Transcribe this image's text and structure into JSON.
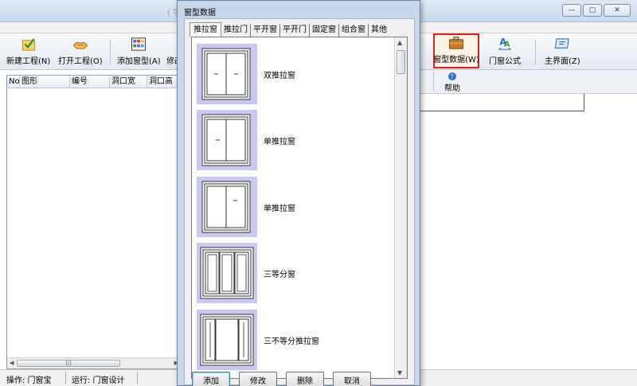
{
  "main": {
    "title": "( 宇",
    "window_buttons": [
      "—",
      "▢",
      "✕"
    ],
    "toolbar": {
      "new_project": "新建工程(N)",
      "open_project": "打开工程(O)",
      "add_window": "添加窗型(A)",
      "modify": "修改",
      "window_data": "窗型数据(W)",
      "formula": "门窗公式",
      "main_screen": "主界面(Z)"
    },
    "toolbar2": {
      "help": "帮助"
    },
    "table": {
      "columns": [
        "No",
        "图形",
        "编号",
        "洞口宽",
        "洞口高"
      ]
    },
    "status": {
      "operator_label": "操作: 门窗宝",
      "run_label": "运行: 门窗设计"
    }
  },
  "dialog": {
    "title": "窗型数据",
    "tabs": [
      "推拉窗",
      "推拉门",
      "平开窗",
      "平开门",
      "固定窗",
      "组合窗",
      "其他"
    ],
    "active_tab": 0,
    "items": [
      {
        "label": "双推拉窗"
      },
      {
        "label": "单推拉窗"
      },
      {
        "label": "单推拉窗"
      },
      {
        "label": "三等分窗"
      },
      {
        "label": "三不等分推拉窗"
      }
    ],
    "buttons": {
      "add": "添加",
      "modify": "修改",
      "delete": "删除",
      "cancel": "取消"
    }
  },
  "colors": {
    "thumb_bg": "#c8c8f3",
    "highlight_border": "#e02020"
  }
}
